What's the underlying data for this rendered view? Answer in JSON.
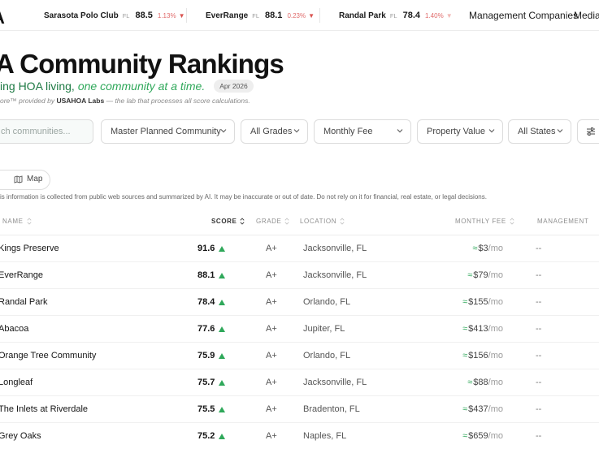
{
  "brand": {
    "logo_glyph": "A"
  },
  "ticker": [
    {
      "name": "Sarasota Polo Club",
      "state": "FL",
      "score": "88.5",
      "change": "1.13%",
      "arrow": "▼"
    },
    {
      "name": "EverRange",
      "state": "FL",
      "score": "88.1",
      "change": "0.23%",
      "arrow": "▼"
    },
    {
      "name": "Randal Park",
      "state": "FL",
      "score": "78.4",
      "change": "1.40%",
      "arrow": "▼"
    }
  ],
  "nav": {
    "management": "Management Companies",
    "media": "Media"
  },
  "hero": {
    "title": "A Community Rankings",
    "tagline_prefix": "ing HOA living,",
    "tagline_emphasis": "one community at a time.",
    "date_badge": "Apr 2026",
    "byline_prefix": "ore™ provided by",
    "byline_lab": "USAHOA Labs",
    "byline_suffix": "— the lab that processes all score calculations."
  },
  "filters": {
    "search_placeholder": "ch communities...",
    "community_type": "Master Planned Community",
    "grades": "All Grades",
    "monthly_fee": "Monthly Fee",
    "property_value": "Property Value",
    "states": "All States"
  },
  "view_toggle": {
    "map_label": "Map"
  },
  "disclaimer": "is information is collected from public web sources and summarized by AI. It may be inaccurate or out of date. Do not rely on it for financial, real estate, or legal decisions.",
  "table": {
    "headers": {
      "name": "Name",
      "score": "Score",
      "grade": "Grade",
      "location": "Location",
      "monthly_fee": "Monthly Fee",
      "management": "Management"
    },
    "rows": [
      {
        "name": "Kings Preserve",
        "score": "91.6",
        "grade": "A+",
        "location": "Jacksonville, FL",
        "fee_approx": "≈",
        "fee": "$3",
        "per": "/mo",
        "management": "--"
      },
      {
        "name": "EverRange",
        "score": "88.1",
        "grade": "A+",
        "location": "Jacksonville, FL",
        "fee_approx": "≈",
        "fee": "$79",
        "per": "/mo",
        "management": "--"
      },
      {
        "name": "Randal Park",
        "score": "78.4",
        "grade": "A+",
        "location": "Orlando, FL",
        "fee_approx": "≈",
        "fee": "$155",
        "per": "/mo",
        "management": "--"
      },
      {
        "name": "Abacoa",
        "score": "77.6",
        "grade": "A+",
        "location": "Jupiter, FL",
        "fee_approx": "≈",
        "fee": "$413",
        "per": "/mo",
        "management": "--"
      },
      {
        "name": "Orange Tree Community",
        "score": "75.9",
        "grade": "A+",
        "location": "Orlando, FL",
        "fee_approx": "≈",
        "fee": "$156",
        "per": "/mo",
        "management": "--"
      },
      {
        "name": "Longleaf",
        "score": "75.7",
        "grade": "A+",
        "location": "Jacksonville, FL",
        "fee_approx": "≈",
        "fee": "$88",
        "per": "/mo",
        "management": "--"
      },
      {
        "name": "The Inlets at Riverdale",
        "score": "75.5",
        "grade": "A+",
        "location": "Bradenton, FL",
        "fee_approx": "≈",
        "fee": "$437",
        "per": "/mo",
        "management": "--"
      },
      {
        "name": "Grey Oaks",
        "score": "75.2",
        "grade": "A+",
        "location": "Naples, FL",
        "fee_approx": "≈",
        "fee": "$659",
        "per": "/mo",
        "management": "--"
      }
    ]
  }
}
